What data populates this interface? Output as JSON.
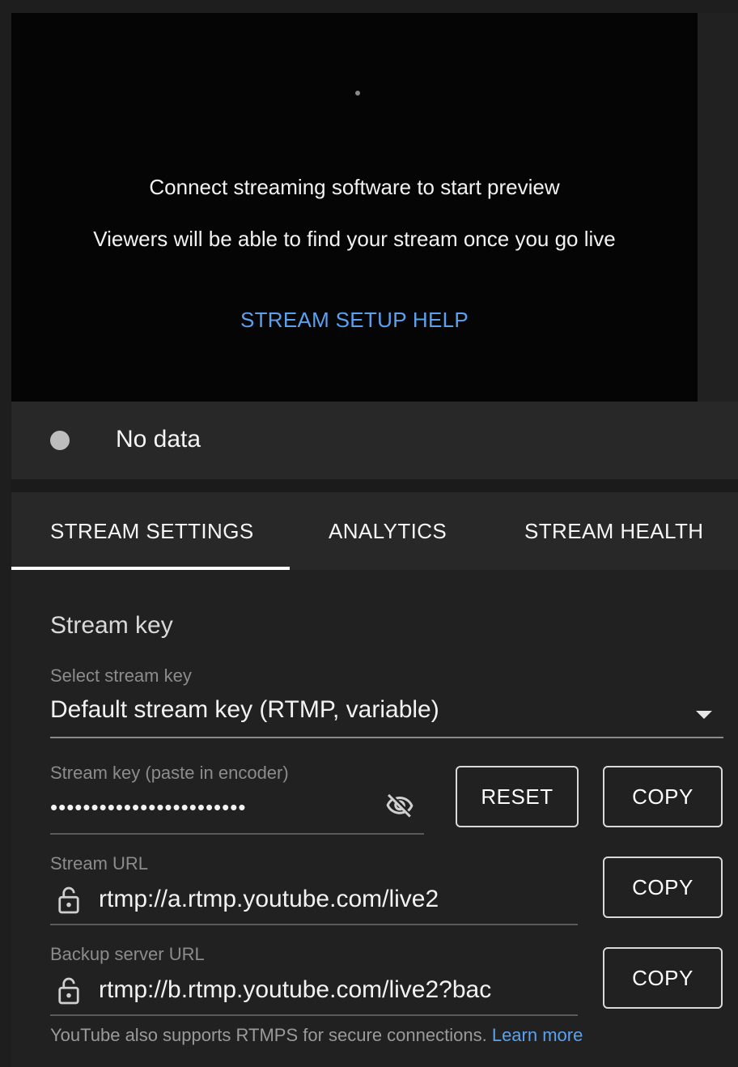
{
  "preview": {
    "line1": "Connect streaming software to start preview",
    "line2": "Viewers will be able to find your stream once you go live",
    "help_link": "STREAM SETUP HELP"
  },
  "status": {
    "text": "No data",
    "dot_color": "#bdbdbd"
  },
  "tabs": [
    {
      "label": "STREAM SETTINGS",
      "active": true
    },
    {
      "label": "ANALYTICS",
      "active": false
    },
    {
      "label": "STREAM HEALTH",
      "active": false
    }
  ],
  "stream_key": {
    "title": "Stream key",
    "select_label": "Select stream key",
    "select_value": "Default stream key (RTMP, variable)",
    "key_label": "Stream key (paste in encoder)",
    "key_value": "••••••••••••••••••••••••",
    "reset_label": "RESET",
    "copy_label": "COPY"
  },
  "stream_url": {
    "label": "Stream URL",
    "value": "rtmp://a.rtmp.youtube.com/live2",
    "copy_label": "COPY"
  },
  "backup_url": {
    "label": "Backup server URL",
    "value": "rtmp://b.rtmp.youtube.com/live2?bac",
    "copy_label": "COPY"
  },
  "footer": {
    "note": "YouTube also supports RTMPS for secure connections.",
    "link": "Learn more"
  },
  "colors": {
    "accent_link": "#5aa1f0",
    "background": "#1e1e1e"
  }
}
